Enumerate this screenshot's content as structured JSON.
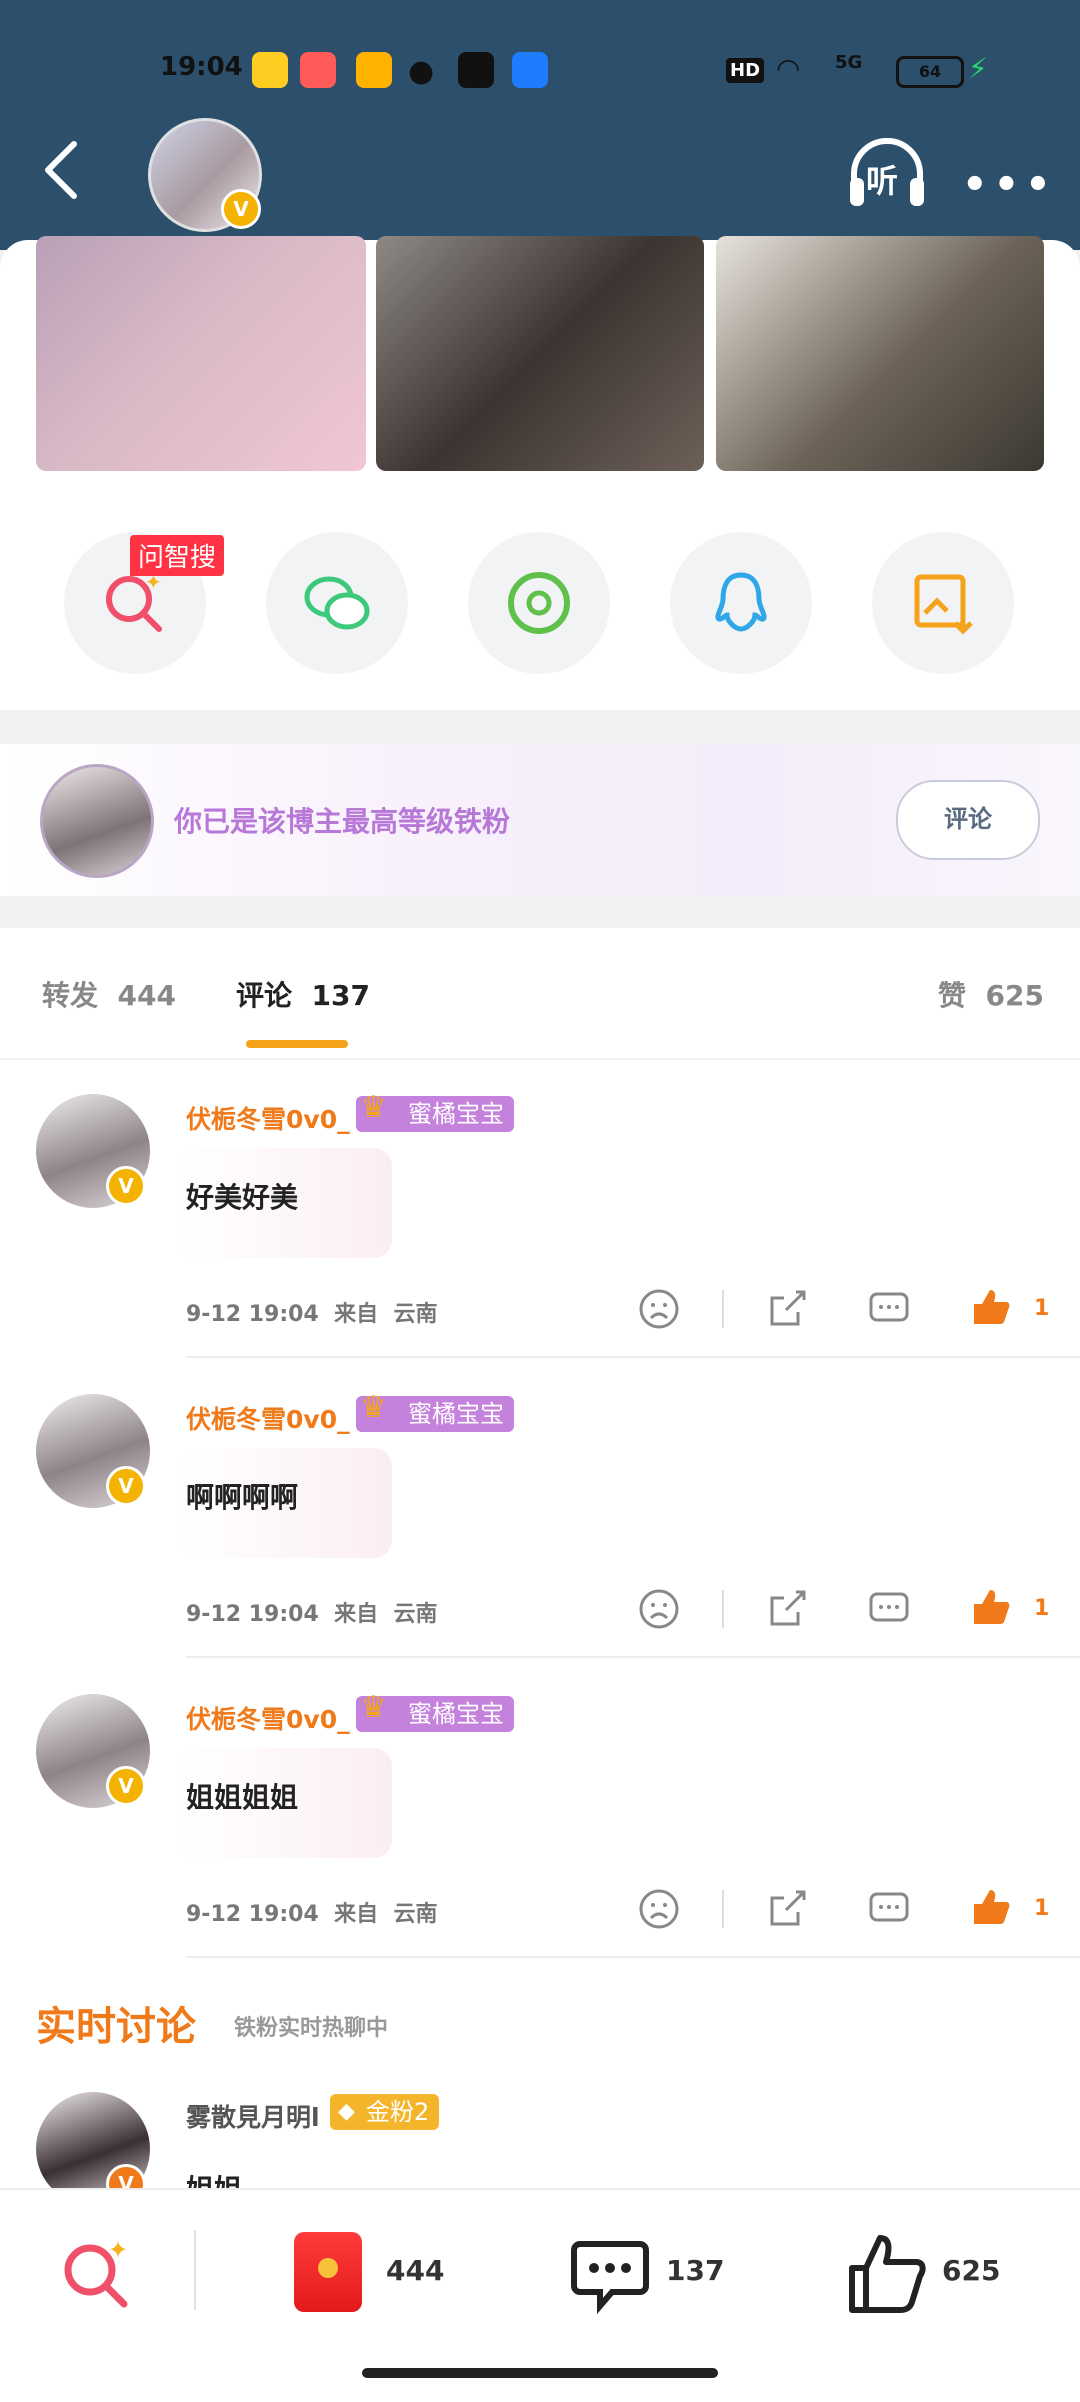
{
  "status_bar": {
    "time": "19:04",
    "hd": "HD",
    "network": "5G",
    "battery": "64"
  },
  "colors": {
    "header_bg": "#2c4f6c",
    "accent_orange": "#f07a1a",
    "fan_purple": "#b778d8",
    "red": "#ff3344"
  },
  "header": {
    "listen_label": "听",
    "more_label": "•••"
  },
  "share": {
    "ai_search_tag": "问智搜",
    "items": [
      "search-ai",
      "wechat",
      "moments",
      "qq",
      "save-image"
    ]
  },
  "fan_strip": {
    "text": "你已是该博主最高等级铁粉",
    "button_label": "评论"
  },
  "tabs": {
    "repost_label": "转发",
    "repost_count": "444",
    "comment_label": "评论",
    "comment_count": "137",
    "like_label": "赞",
    "like_count": "625"
  },
  "comments": [
    {
      "name": "伏栀冬雪0v0_",
      "badge": "蜜橘宝宝",
      "text": "好美好美",
      "date": "9-12",
      "time": "19:04",
      "from": "来自",
      "location": "云南",
      "likes": "1"
    },
    {
      "name": "伏栀冬雪0v0_",
      "badge": "蜜橘宝宝",
      "text": "啊啊啊啊",
      "date": "9-12",
      "time": "19:04",
      "from": "来自",
      "location": "云南",
      "likes": "1"
    },
    {
      "name": "伏栀冬雪0v0_",
      "badge": "蜜橘宝宝",
      "text": "姐姐姐姐",
      "date": "9-12",
      "time": "19:04",
      "from": "来自",
      "location": "云南",
      "likes": "1"
    }
  ],
  "realtime": {
    "title": "实时讨论",
    "subtitle": "铁粉实时热聊中",
    "user": {
      "name": "雾散見月明l",
      "badge": "金粉2",
      "text": "姐姐"
    }
  },
  "bottom_bar": {
    "repost_count": "444",
    "comment_count": "137",
    "like_count": "625"
  }
}
